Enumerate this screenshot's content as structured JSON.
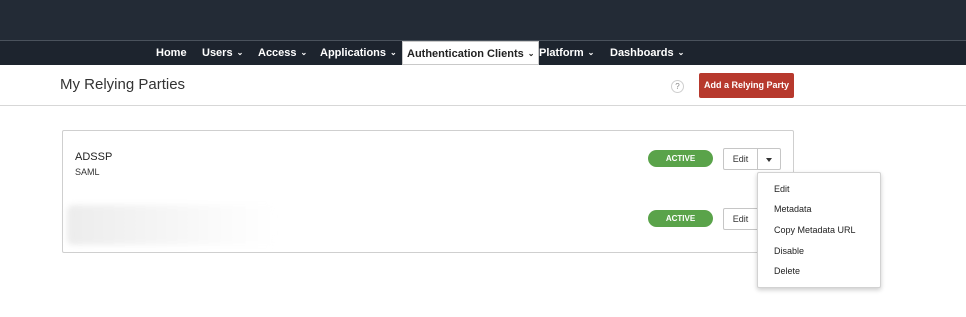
{
  "nav": {
    "items": [
      {
        "label": "Home",
        "dropdown": false
      },
      {
        "label": "Users",
        "dropdown": true
      },
      {
        "label": "Access",
        "dropdown": true
      },
      {
        "label": "Applications",
        "dropdown": true
      },
      {
        "label": "Authentication Clients",
        "dropdown": true,
        "active": true
      },
      {
        "label": "Platform",
        "dropdown": true
      },
      {
        "label": "Dashboards",
        "dropdown": true
      }
    ],
    "chevron": "⌄"
  },
  "header": {
    "title": "My Relying Parties",
    "help_label": "?",
    "add_button_label": "Add a Relying Party"
  },
  "parties": [
    {
      "name": "ADSSP",
      "type": "SAML",
      "status": "ACTIVE",
      "edit_label": "Edit"
    },
    {
      "name": "",
      "type": "",
      "status": "ACTIVE",
      "edit_label": "Edit"
    }
  ],
  "menu": {
    "items": [
      "Edit",
      "Metadata",
      "Copy Metadata URL",
      "Disable",
      "Delete"
    ]
  },
  "colors": {
    "topbar": "#232b36",
    "active_badge": "#5aa34a",
    "primary_button": "#b7392d"
  }
}
